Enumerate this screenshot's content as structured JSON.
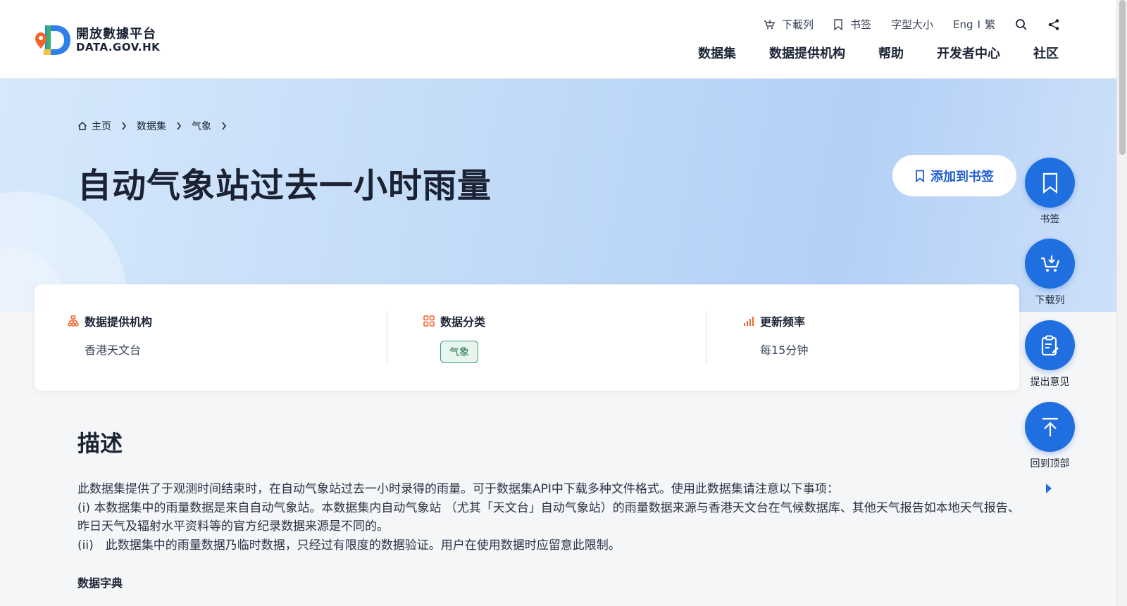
{
  "header": {
    "logo": {
      "cn": "開放數據平台",
      "en": "DATA.GOV.HK"
    },
    "util": {
      "download_list": "下載列",
      "bookmark": "书签",
      "font_size": "字型大小",
      "lang_en": "Eng",
      "lang_sep": "I",
      "lang_tc": "繁"
    },
    "nav": [
      "数据集",
      "数据提供机构",
      "帮助",
      "开发者中心",
      "社区"
    ]
  },
  "breadcrumb": [
    "主页",
    "数据集",
    "气象"
  ],
  "page_title": "自动气象站过去一小时雨量",
  "add_bookmark": "添加到书签",
  "fabs": {
    "bookmark": "书签",
    "download_list": "下载列",
    "feedback": "提出意见",
    "back_to_top": "回到顶部"
  },
  "info": {
    "provider_label": "数据提供机构",
    "provider_value": "香港天文台",
    "category_label": "数据分类",
    "category_tag": "气象",
    "frequency_label": "更新频率",
    "frequency_value": "每15分钟"
  },
  "description": {
    "title": "描述",
    "lines": [
      "此数据集提供了于观测时间结束时，在自动气象站过去一小时录得的雨量。可于数据集API中下载多种文件格式。使用此数据集请注意以下事项：",
      "(i) 本数据集中的雨量数据是来自自动气象站。本数据集内自动气象站 （尤其「天文台」自动气象站）的雨量数据来源与香港天文台在气候数据库、其他天气报告如本地天气报告、昨日天气及辐射水平资料等的官方纪录数据来源是不同的。",
      "(ii)　此数据集中的雨量数据乃临时数据，只经过有限度的数据验证。用户在使用数据时应留意此限制。"
    ],
    "dictionary_title": "数据字典"
  },
  "colors": {
    "primary": "#1f6fe0",
    "accent_orange": "#f0642d",
    "tag_green": "#3d9c6e"
  }
}
